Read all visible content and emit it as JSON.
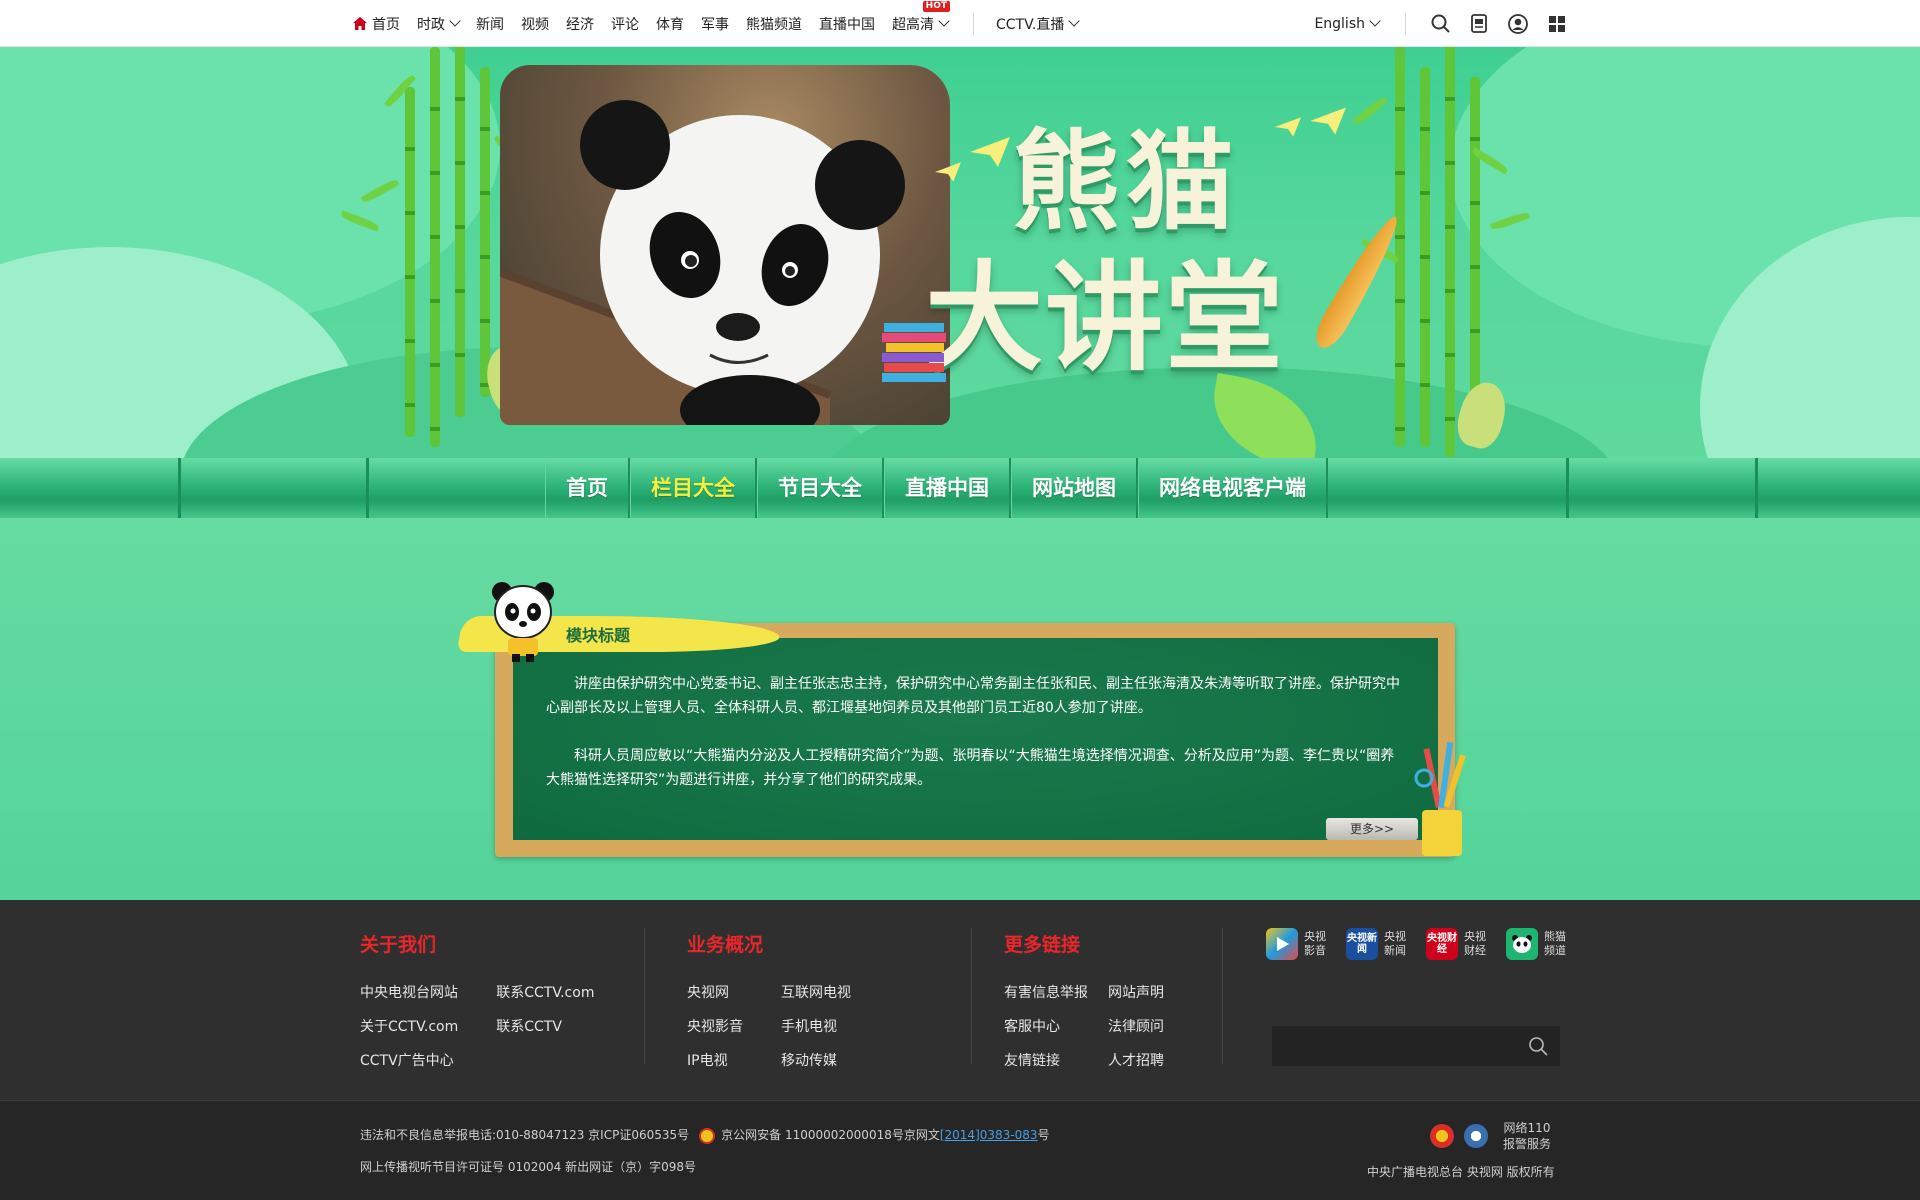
{
  "topnav": {
    "items": [
      {
        "label": "首页",
        "has_icon": true
      },
      {
        "label": "时政",
        "dropdown": true
      },
      {
        "label": "新闻"
      },
      {
        "label": "视频"
      },
      {
        "label": "经济"
      },
      {
        "label": "评论"
      },
      {
        "label": "体育"
      },
      {
        "label": "军事"
      },
      {
        "label": "熊猫频道"
      },
      {
        "label": "直播中国"
      },
      {
        "label": "超高清",
        "dropdown": true,
        "badge": "HOT"
      }
    ],
    "live_label": "CCTV.直播",
    "lang_label": "English",
    "icons": [
      "search-icon",
      "app-download-icon",
      "user-icon",
      "grid-menu-icon"
    ],
    "home_icon_color": "#d0021b"
  },
  "banner": {
    "title_line1": "熊猫",
    "title_line2": "大讲堂"
  },
  "band_menu": {
    "items": [
      "首页",
      "栏目大全",
      "节目大全",
      "直播中国",
      "网站地图",
      "网络电视客户端"
    ],
    "active_index": 1,
    "active_color": "#f8ef3a"
  },
  "module": {
    "title": "模块标题",
    "paragraphs": [
      "讲座由保护研究中心党委书记、副主任张志忠主持，保护研究中心常务副主任张和民、副主任张海清及朱涛等听取了讲座。保护研究中心副部长及以上管理人员、全体科研人员、都江堰基地饲养员及其他部门员工近80人参加了讲座。",
      "科研人员周应敏以“大熊猫内分泌及人工授精研究简介”为题、张明春以“大熊猫生境选择情况调查、分析及应用”为题、李仁贵以“圈养大熊猫性选择研究”为题进行讲座，并分享了他们的研究成果。"
    ],
    "more_label": "更多>>"
  },
  "footer": {
    "columns": [
      {
        "title": "关于我们",
        "links": [
          "中央电视台网站",
          "联系CCTV.com",
          "关于CCTV.com",
          "联系CCTV",
          "CCTV广告中心"
        ]
      },
      {
        "title": "业务概况",
        "links": [
          "央视网",
          "互联网电视",
          "央视影音",
          "手机电视",
          "IP电视",
          "移动传媒"
        ]
      },
      {
        "title": "更多链接",
        "links": [
          "有害信息举报",
          "网站声明",
          "客服中心",
          "法律顾问",
          "友情链接",
          "人才招聘"
        ]
      }
    ],
    "apps": [
      {
        "label": "央视影音",
        "icon_text": "▶",
        "color": "#1e9be0"
      },
      {
        "label": "央视新闻",
        "icon_text": "央视新闻",
        "color": "#1a4fa0"
      },
      {
        "label": "央视财经",
        "icon_text": "央视财经",
        "color": "#d0021b"
      },
      {
        "label": "熊猫频道",
        "icon_text": "●",
        "color": "#1db56f"
      }
    ],
    "accent_color": "#e9262b"
  },
  "legal": {
    "line1_a": "违法和不良信息举报电话:010-88047123 京ICP证060535号",
    "line1_b": "京公网安备 11000002000018号京网文",
    "line1_link": "[2014]0383-083",
    "line1_c": "号",
    "line2": "网上传播视听节目许可证号 0102004 新出网证（京）字098号",
    "report_text": "网络110报警服务",
    "copyright": "中央广播电视总台 央视网 版权所有"
  }
}
